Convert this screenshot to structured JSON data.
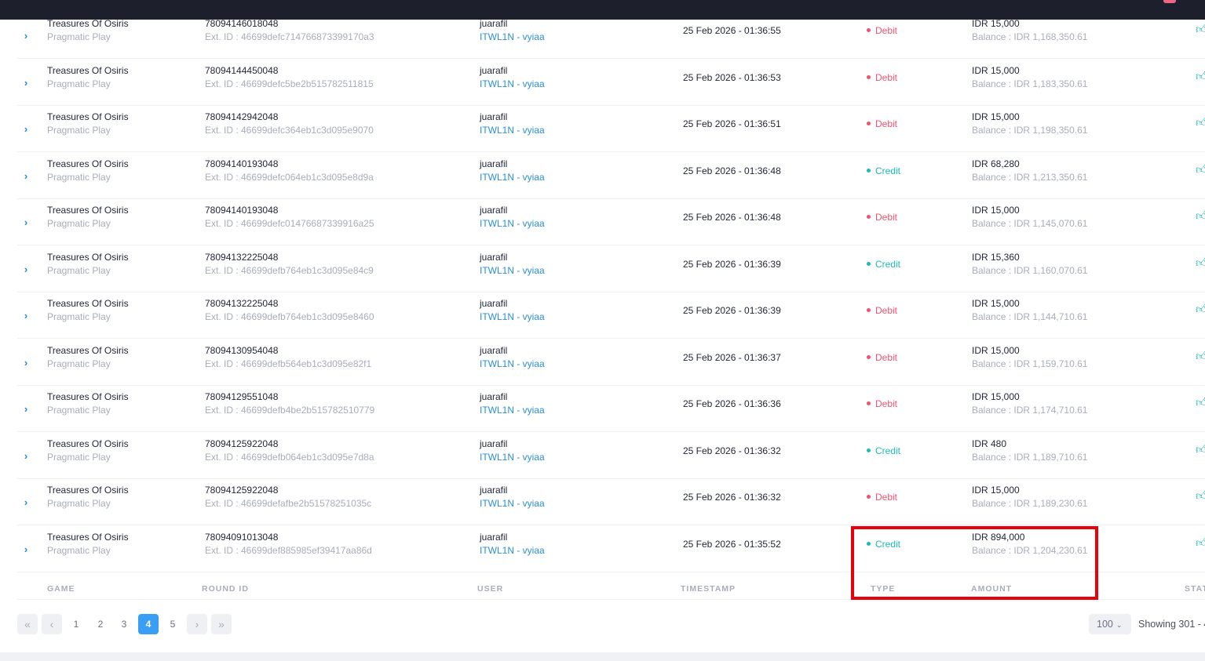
{
  "header": {
    "badge_color": "#f06585"
  },
  "icons": {
    "expand": "chevron-right-icon",
    "status": "thumbs-up-icon"
  },
  "colors": {
    "debit": "#f1536e",
    "credit": "#1cbbb4",
    "link": "#2a8fd6",
    "active_page": "#3b9ef5",
    "highlight": "#e8000b"
  },
  "rows": [
    {
      "game": "Treasures Of Osiris",
      "provider": "Pragmatic Play",
      "round_id": "78094146018048",
      "ext_id": "Ext. ID : 46699defc714766873399170a3",
      "user": "juarafil",
      "user_sub": "ITWL1N - vyiaa",
      "timestamp": "25 Feb 2026 - 01:36:55",
      "type": "Debit",
      "amount": "IDR 15,000",
      "balance": "Balance : IDR 1,168,350.61"
    },
    {
      "game": "Treasures Of Osiris",
      "provider": "Pragmatic Play",
      "round_id": "78094144450048",
      "ext_id": "Ext. ID : 46699defc5be2b515782511815",
      "user": "juarafil",
      "user_sub": "ITWL1N - vyiaa",
      "timestamp": "25 Feb 2026 - 01:36:53",
      "type": "Debit",
      "amount": "IDR 15,000",
      "balance": "Balance : IDR 1,183,350.61"
    },
    {
      "game": "Treasures Of Osiris",
      "provider": "Pragmatic Play",
      "round_id": "78094142942048",
      "ext_id": "Ext. ID : 46699defc364eb1c3d095e9070",
      "user": "juarafil",
      "user_sub": "ITWL1N - vyiaa",
      "timestamp": "25 Feb 2026 - 01:36:51",
      "type": "Debit",
      "amount": "IDR 15,000",
      "balance": "Balance : IDR 1,198,350.61"
    },
    {
      "game": "Treasures Of Osiris",
      "provider": "Pragmatic Play",
      "round_id": "78094140193048",
      "ext_id": "Ext. ID : 46699defc064eb1c3d095e8d9a",
      "user": "juarafil",
      "user_sub": "ITWL1N - vyiaa",
      "timestamp": "25 Feb 2026 - 01:36:48",
      "type": "Credit",
      "amount": "IDR 68,280",
      "balance": "Balance : IDR 1,213,350.61"
    },
    {
      "game": "Treasures Of Osiris",
      "provider": "Pragmatic Play",
      "round_id": "78094140193048",
      "ext_id": "Ext. ID : 46699defc01476687339916a25",
      "user": "juarafil",
      "user_sub": "ITWL1N - vyiaa",
      "timestamp": "25 Feb 2026 - 01:36:48",
      "type": "Debit",
      "amount": "IDR 15,000",
      "balance": "Balance : IDR 1,145,070.61"
    },
    {
      "game": "Treasures Of Osiris",
      "provider": "Pragmatic Play",
      "round_id": "78094132225048",
      "ext_id": "Ext. ID : 46699defb764eb1c3d095e84c9",
      "user": "juarafil",
      "user_sub": "ITWL1N - vyiaa",
      "timestamp": "25 Feb 2026 - 01:36:39",
      "type": "Credit",
      "amount": "IDR 15,360",
      "balance": "Balance : IDR 1,160,070.61"
    },
    {
      "game": "Treasures Of Osiris",
      "provider": "Pragmatic Play",
      "round_id": "78094132225048",
      "ext_id": "Ext. ID : 46699defb764eb1c3d095e8460",
      "user": "juarafil",
      "user_sub": "ITWL1N - vyiaa",
      "timestamp": "25 Feb 2026 - 01:36:39",
      "type": "Debit",
      "amount": "IDR 15,000",
      "balance": "Balance : IDR 1,144,710.61"
    },
    {
      "game": "Treasures Of Osiris",
      "provider": "Pragmatic Play",
      "round_id": "78094130954048",
      "ext_id": "Ext. ID : 46699defb564eb1c3d095e82f1",
      "user": "juarafil",
      "user_sub": "ITWL1N - vyiaa",
      "timestamp": "25 Feb 2026 - 01:36:37",
      "type": "Debit",
      "amount": "IDR 15,000",
      "balance": "Balance : IDR 1,159,710.61"
    },
    {
      "game": "Treasures Of Osiris",
      "provider": "Pragmatic Play",
      "round_id": "78094129551048",
      "ext_id": "Ext. ID : 46699defb4be2b515782510779",
      "user": "juarafil",
      "user_sub": "ITWL1N - vyiaa",
      "timestamp": "25 Feb 2026 - 01:36:36",
      "type": "Debit",
      "amount": "IDR 15,000",
      "balance": "Balance : IDR 1,174,710.61"
    },
    {
      "game": "Treasures Of Osiris",
      "provider": "Pragmatic Play",
      "round_id": "78094125922048",
      "ext_id": "Ext. ID : 46699defb064eb1c3d095e7d8a",
      "user": "juarafil",
      "user_sub": "ITWL1N - vyiaa",
      "timestamp": "25 Feb 2026 - 01:36:32",
      "type": "Credit",
      "amount": "IDR 480",
      "balance": "Balance : IDR 1,189,710.61"
    },
    {
      "game": "Treasures Of Osiris",
      "provider": "Pragmatic Play",
      "round_id": "78094125922048",
      "ext_id": "Ext. ID : 46699defafbe2b51578251035c",
      "user": "juarafil",
      "user_sub": "ITWL1N - vyiaa",
      "timestamp": "25 Feb 2026 - 01:36:32",
      "type": "Debit",
      "amount": "IDR 15,000",
      "balance": "Balance : IDR 1,189,230.61"
    },
    {
      "game": "Treasures Of Osiris",
      "provider": "Pragmatic Play",
      "round_id": "78094091013048",
      "ext_id": "Ext. ID : 46699def885985ef39417aa86d",
      "user": "juarafil",
      "user_sub": "ITWL1N - vyiaa",
      "timestamp": "25 Feb 2026 - 01:35:52",
      "type": "Credit",
      "amount": "IDR 894,000",
      "balance": "Balance : IDR 1,204,230.61"
    }
  ],
  "columns": {
    "game": "GAME",
    "round_id": "ROUND ID",
    "user": "USER",
    "timestamp": "TIMESTAMP",
    "type": "TYPE",
    "amount": "AMOUNT",
    "status": "STAT"
  },
  "pagination": {
    "first": "«",
    "prev": "‹",
    "next": "›",
    "last": "»",
    "pages": [
      "1",
      "2",
      "3",
      "4",
      "5"
    ],
    "active": "4",
    "per_page": "100",
    "showing": "Showing 301 - 4"
  }
}
